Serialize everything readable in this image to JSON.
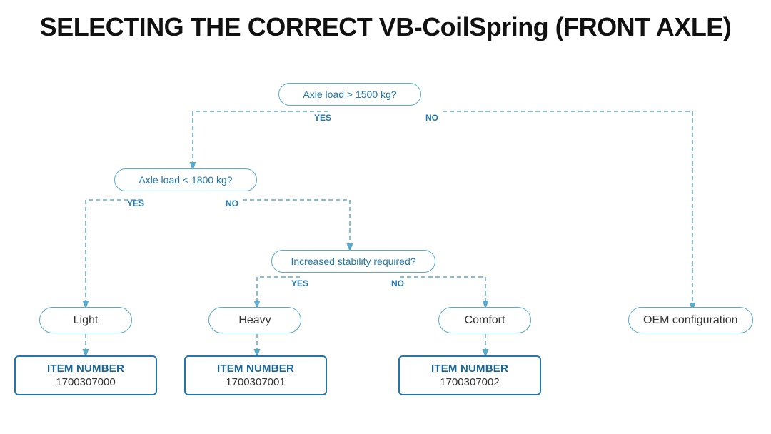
{
  "title": "SELECTING THE CORRECT VB-CoilSpring (FRONT AXLE)",
  "decisions": [
    {
      "id": "d1",
      "text": "Axle load > 1500 kg?",
      "yes_label": "YES",
      "no_label": "NO"
    },
    {
      "id": "d2",
      "text": "Axle load < 1800 kg?",
      "yes_label": "YES",
      "no_label": "NO"
    },
    {
      "id": "d3",
      "text": "Increased stability required?",
      "yes_label": "YES",
      "no_label": "NO"
    }
  ],
  "results": [
    {
      "id": "r1",
      "label": "Light"
    },
    {
      "id": "r2",
      "label": "Heavy"
    },
    {
      "id": "r3",
      "label": "Comfort"
    },
    {
      "id": "r4",
      "label": "OEM configuration"
    }
  ],
  "items": [
    {
      "id": "i1",
      "label": "ITEM NUMBER",
      "number": "1700307000"
    },
    {
      "id": "i2",
      "label": "ITEM NUMBER",
      "number": "1700307001"
    },
    {
      "id": "i3",
      "label": "ITEM NUMBER",
      "number": "1700307002"
    }
  ]
}
